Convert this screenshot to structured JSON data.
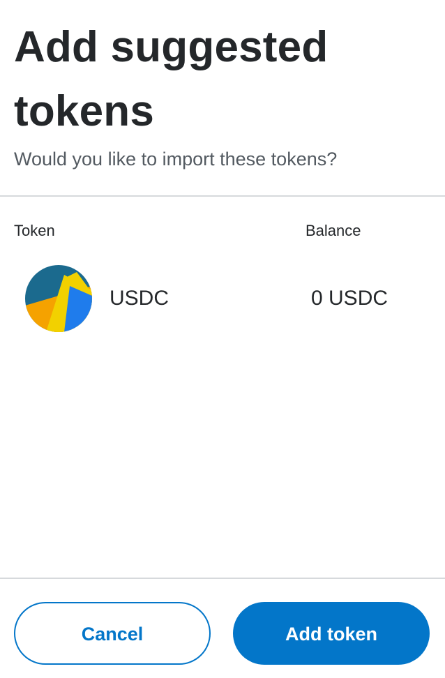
{
  "header": {
    "title": "Add suggested tokens",
    "subtitle": "Would you like to import these tokens?"
  },
  "table": {
    "col_token": "Token",
    "col_balance": "Balance",
    "rows": [
      {
        "symbol": "USDC",
        "balance": "0 USDC",
        "icon": "token-identicon"
      }
    ]
  },
  "actions": {
    "cancel_label": "Cancel",
    "add_label": "Add token"
  },
  "colors": {
    "primary": "#0376c9",
    "text": "#24272a",
    "muted": "#535a61",
    "divider": "#d6d9dc"
  }
}
